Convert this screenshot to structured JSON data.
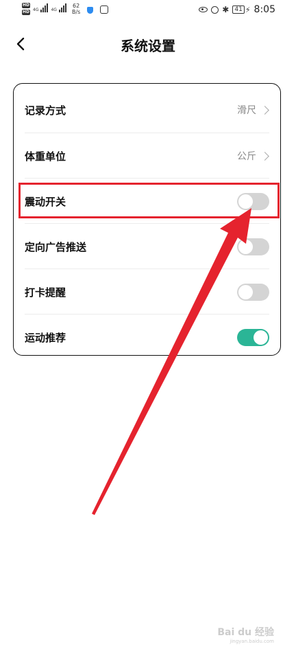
{
  "status_bar": {
    "hd1": "HD",
    "hd2": "HD",
    "net1": "4G",
    "net2": "4G",
    "speed_value": "62",
    "speed_unit": "B/s",
    "battery": "41",
    "time": "8:05"
  },
  "header": {
    "title": "系统设置"
  },
  "settings": {
    "record_mode": {
      "label": "记录方式",
      "value": "滑尺"
    },
    "weight_unit": {
      "label": "体重单位",
      "value": "公斤"
    },
    "vibration": {
      "label": "震动开关",
      "on": false
    },
    "targeted_ads": {
      "label": "定向广告推送",
      "on": false
    },
    "checkin_reminder": {
      "label": "打卡提醒",
      "on": false
    },
    "exercise_recommend": {
      "label": "运动推荐",
      "on": true
    }
  },
  "colors": {
    "toggle_on": "#2bb596",
    "toggle_off": "#d4d4d4",
    "annotation": "#e5232e"
  },
  "watermark": {
    "brand": "Bai du 经验",
    "url": "jingyan.baidu.com"
  }
}
